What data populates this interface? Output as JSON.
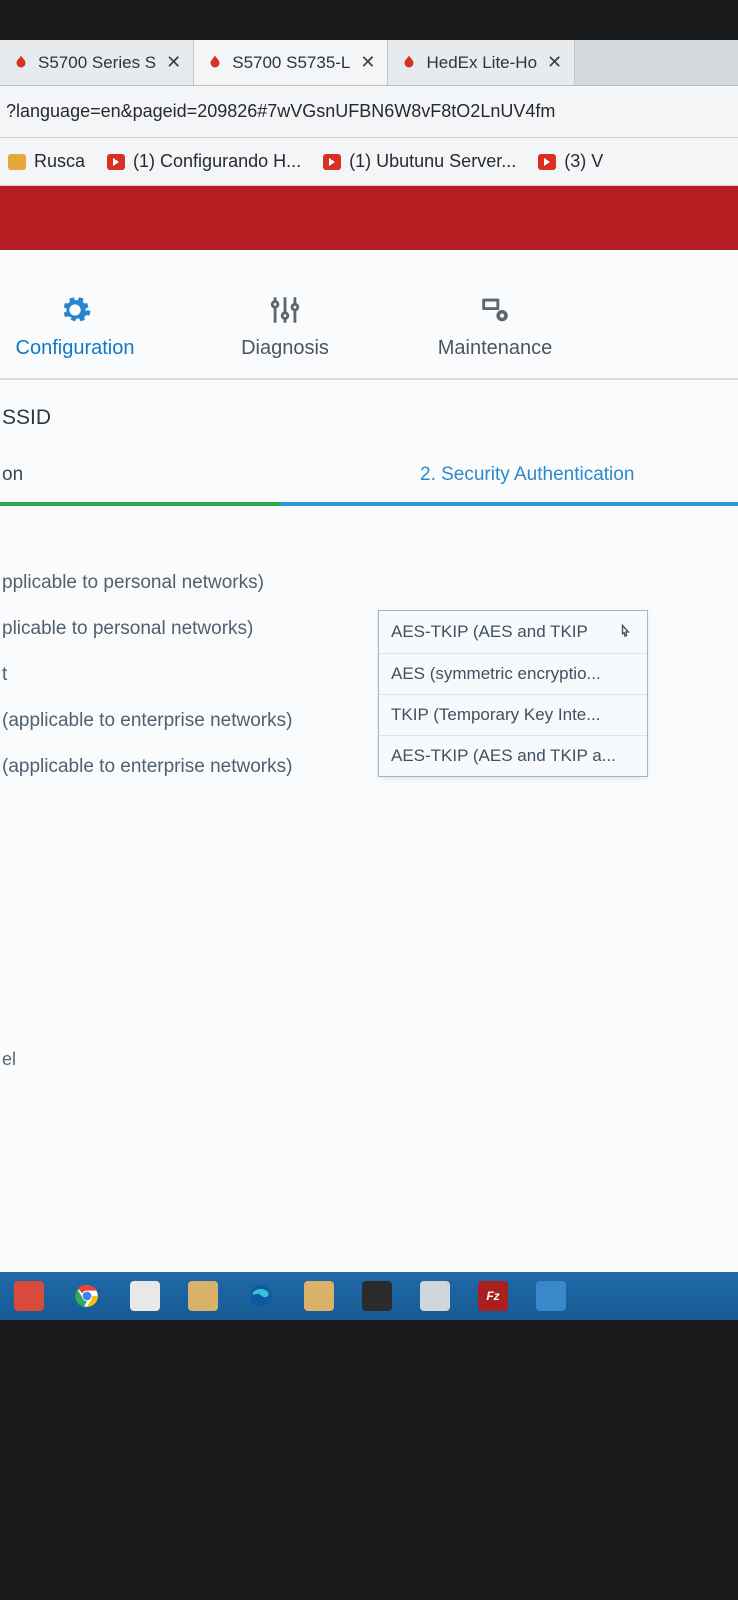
{
  "browser": {
    "tabs": [
      {
        "label": "S5700 Series S",
        "active": false
      },
      {
        "label": "S5700 S5735-L",
        "active": true
      },
      {
        "label": "HedEx Lite-Ho",
        "active": false
      }
    ],
    "url": "?language=en&pageid=209826#7wVGsnUFBN6W8vF8tO2LnUV4fm",
    "bookmarks": [
      {
        "label": "Rusca",
        "icon": "folder"
      },
      {
        "label": "(1) Configurando H...",
        "icon": "yt"
      },
      {
        "label": "(1) Ubutunu Server...",
        "icon": "yt"
      },
      {
        "label": "(3) V",
        "icon": "yt"
      }
    ]
  },
  "nav": {
    "items": [
      {
        "label": "Configuration",
        "active": true
      },
      {
        "label": "Diagnosis",
        "active": false
      },
      {
        "label": "Maintenance",
        "active": false
      }
    ]
  },
  "page": {
    "section_title": "SSID",
    "steps": {
      "step1_partial": "on",
      "step2": "2. Security Authentication"
    },
    "options": [
      "pplicable to personal networks)",
      "plicable to personal networks)",
      "t",
      "(applicable to enterprise networks)",
      "(applicable to enterprise networks)"
    ],
    "cancel_partial": "el",
    "dropdown": {
      "selected": "AES-TKIP (AES and TKIP",
      "items": [
        "AES-TKIP (AES and TKIP",
        "AES (symmetric encryptio...",
        "TKIP (Temporary Key Inte...",
        "AES-TKIP (AES and TKIP a..."
      ]
    }
  },
  "taskbar": {
    "items": [
      "app",
      "chrome",
      "lan",
      "files",
      "edge",
      "explorer",
      "term",
      "xbox",
      "fz",
      "rdp"
    ]
  }
}
